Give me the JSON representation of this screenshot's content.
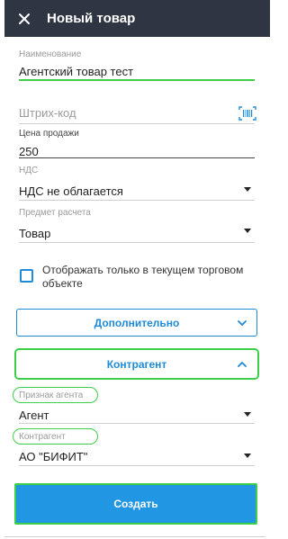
{
  "header": {
    "title": "Новый товар",
    "close_icon": "close-icon"
  },
  "fields": {
    "name": {
      "label": "Наименование",
      "value": "Агентский товар тест"
    },
    "barcode": {
      "placeholder": "Штрих-код",
      "icon": "barcode-scan-icon"
    },
    "price": {
      "label": "Цена продажи",
      "value": "250"
    },
    "vat": {
      "label": "НДС",
      "value": "НДС не облагается"
    },
    "subject": {
      "label": "Предмет расчета",
      "value": "Товар"
    },
    "agent_sign": {
      "label": "Признак агента",
      "value": "Агент"
    },
    "counterparty": {
      "label": "Контрагент",
      "value": "АО \"БИФИТ\""
    }
  },
  "checkbox": {
    "label": "Отображать только в текущем торговом объекте",
    "checked": false
  },
  "sections": {
    "additional": {
      "label": "Дополнительно",
      "expanded": false
    },
    "counterparty": {
      "label": "Контрагент",
      "expanded": true
    }
  },
  "create_button": {
    "label": "Создать"
  },
  "colors": {
    "header_bg": "#2f3542",
    "accent": "#1e8bd8",
    "highlight": "#3ecf4a",
    "primary_button": "#2196e3"
  }
}
